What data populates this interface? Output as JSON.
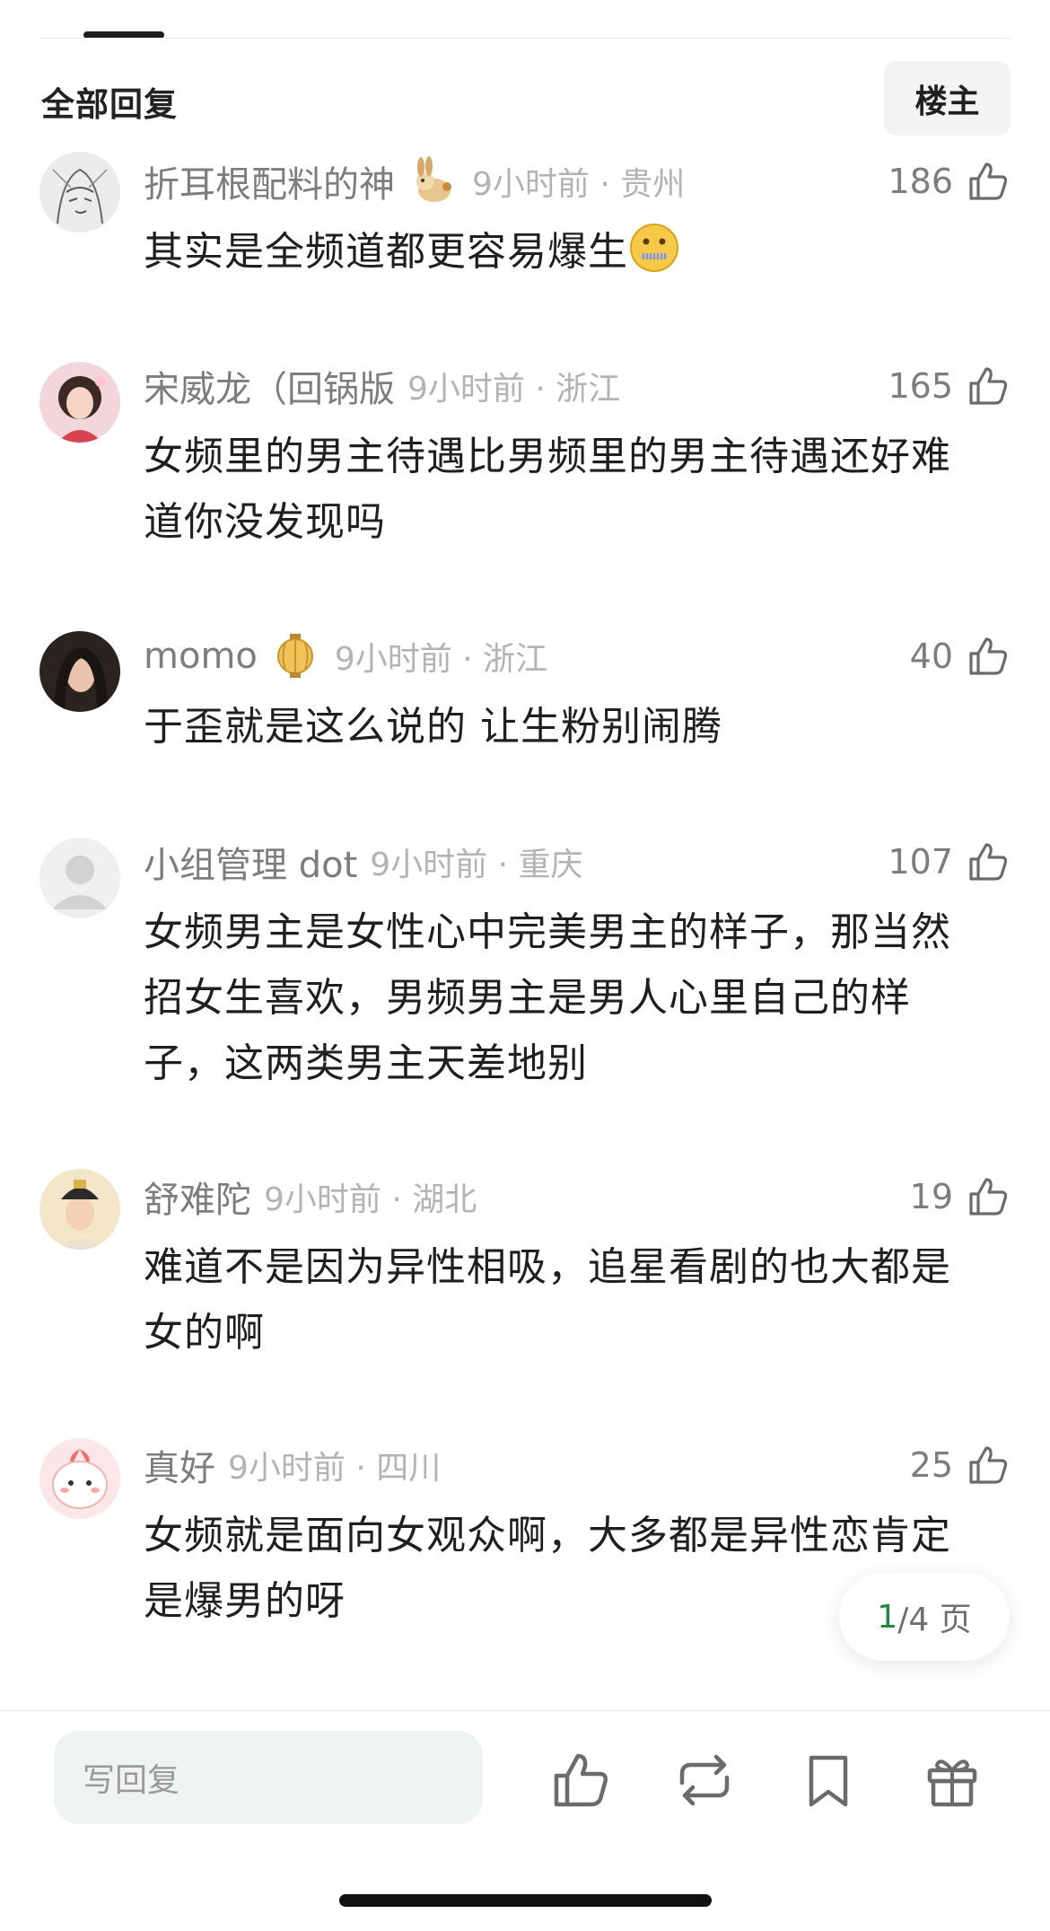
{
  "header": {
    "section_title": "全部回复",
    "op_filter_label": "楼主"
  },
  "comments": [
    {
      "username": "折耳根配料的神",
      "badge_icon": "rabbit-badge-icon",
      "time": "9小时前",
      "location": "贵州",
      "time_location": "9小时前 · 贵州",
      "likes": "186",
      "text": "其实是全频道都更容易爆生",
      "emoji": "zipper-mouth-face"
    },
    {
      "username": "宋威龙（回锅版",
      "time": "9小时前",
      "location": "浙江",
      "time_location": "9小时前 · 浙江",
      "likes": "165",
      "text": "女频里的男主待遇比男频里的男主待遇还好难道你没发现吗"
    },
    {
      "username": "momo",
      "badge_icon": "lantern-badge-icon",
      "time": "9小时前",
      "location": "浙江",
      "time_location": "9小时前 · 浙江",
      "likes": "40",
      "text": "于歪就是这么说的 让生粉别闹腾"
    },
    {
      "username": "小组管理 dot",
      "time": "9小时前",
      "location": "重庆",
      "time_location": "9小时前 · 重庆",
      "likes": "107",
      "text": "女频男主是女性心中完美男主的样子，那当然招女生喜欢，男频男主是男人心里自己的样子，这两类男主天差地别"
    },
    {
      "username": "舒难陀",
      "time": "9小时前",
      "location": "湖北",
      "time_location": "9小时前 · 湖北",
      "likes": "19",
      "text": "难道不是因为异性相吸，追星看剧的也大都是女的啊"
    },
    {
      "username": "真好",
      "time": "9小时前",
      "location": "四川",
      "time_location": "9小时前 · 四川",
      "likes": "25",
      "text": "女频就是面向女观众啊，大多都是异性恋肯定是爆男的呀"
    }
  ],
  "pagination": {
    "current": "1",
    "total_suffix": "/4 页"
  },
  "bottom_bar": {
    "reply_placeholder": "写回复",
    "actions": [
      "like-icon",
      "repost-icon",
      "bookmark-icon",
      "gift-icon"
    ]
  },
  "colors": {
    "accent_green": "#1f8a3a",
    "input_bg": "#eff4f1",
    "meta_gray": "#b3b3b3"
  }
}
